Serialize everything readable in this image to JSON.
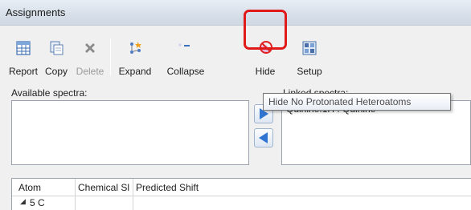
{
  "window": {
    "title": "Assignments"
  },
  "toolbar": {
    "report": "Report",
    "copy": "Copy",
    "delete": "Delete",
    "expand": "Expand",
    "collapse": "Collapse",
    "hide": "Hide",
    "setup": "Setup"
  },
  "available": {
    "label": "Available spectra:"
  },
  "linked": {
    "label": "Linked spectra:",
    "item": "Quinine.1H : Quinine"
  },
  "tooltip": {
    "text": "Hide No Protonated Heteroatoms"
  },
  "grid": {
    "columns": [
      "Atom",
      "Chemical Sl",
      "Predicted Shift"
    ],
    "rows": [
      {
        "atom": "5 C",
        "expand_glyph": "◢"
      }
    ]
  },
  "colors": {
    "highlight": "#e01919",
    "arrow_blue": "#2f74d0"
  }
}
